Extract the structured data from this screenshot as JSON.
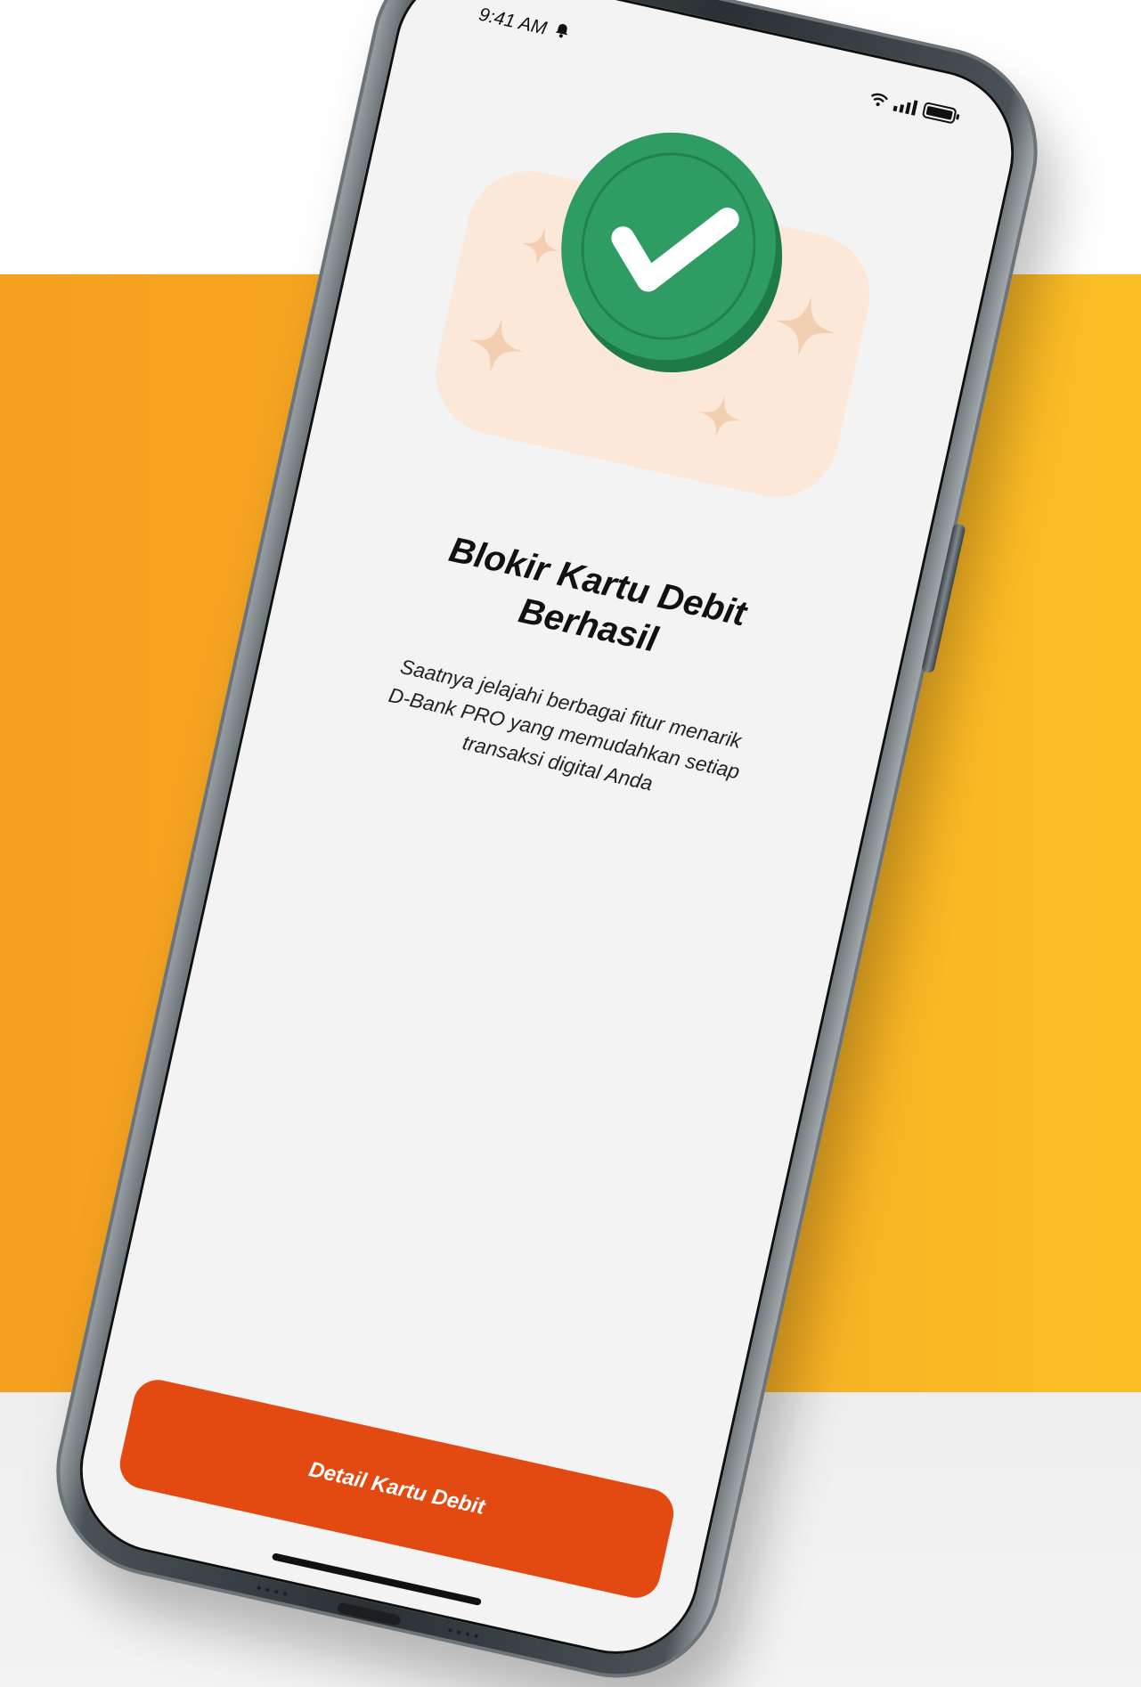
{
  "status_bar": {
    "time": "9:41 AM",
    "notification_icon": "bell-icon",
    "icons": [
      "wifi-icon",
      "signal-icon",
      "battery-icon"
    ]
  },
  "illustration": {
    "icon": "check-circle-icon",
    "colors": {
      "coin": "#2f9d63",
      "coin_dark": "#1f7a49",
      "background": "#fbe8d8",
      "sparkle": "#f2cfb0"
    }
  },
  "content": {
    "title_line1": "Blokir Kartu Debit",
    "title_line2": "Berhasil",
    "subtitle_line1": "Saatnya jelajahi berbagai fitur menarik",
    "subtitle_line2": "D-Bank PRO yang memudahkan setiap",
    "subtitle_line3": "transaksi digital Anda"
  },
  "actions": {
    "primary_label": "Detail Kartu Debit"
  },
  "colors": {
    "accent": "#e34a11",
    "background_orange": "#f7ab23",
    "background_grey": "#f0f0f0",
    "screen": "#f3f3f3"
  }
}
